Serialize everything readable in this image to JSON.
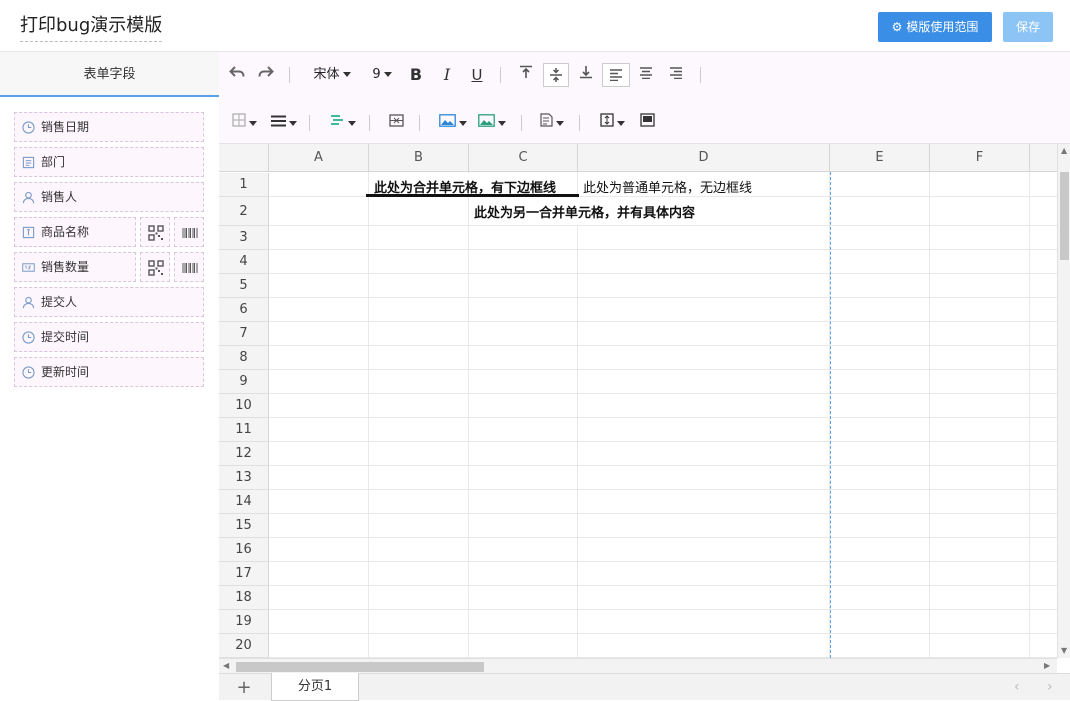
{
  "header": {
    "title": "打印bug演示模版",
    "scope_button": "模版使用范围",
    "save_button": "保存"
  },
  "sidebar": {
    "heading": "表单字段",
    "fields": [
      {
        "label": "销售日期",
        "icon": "clock-icon"
      },
      {
        "label": "部门",
        "icon": "department-icon"
      },
      {
        "label": "销售人",
        "icon": "user-icon"
      },
      {
        "label": "商品名称",
        "icon": "text-field-icon",
        "extras": [
          "qrcode-icon",
          "barcode-icon"
        ]
      },
      {
        "label": "销售数量",
        "icon": "number-field-icon",
        "extras": [
          "qrcode-icon",
          "barcode-icon"
        ]
      },
      {
        "label": "提交人",
        "icon": "user-icon"
      },
      {
        "label": "提交时间",
        "icon": "clock-icon"
      },
      {
        "label": "更新时间",
        "icon": "clock-icon"
      }
    ]
  },
  "toolbar": {
    "font_family": "宋体",
    "font_size": "9"
  },
  "sheet": {
    "columns": [
      "A",
      "B",
      "C",
      "D",
      "E",
      "F"
    ],
    "rows": [
      "1",
      "2",
      "3",
      "4",
      "5",
      "6",
      "7",
      "8",
      "9",
      "10",
      "11",
      "12",
      "13",
      "14",
      "15",
      "16",
      "17",
      "18",
      "19",
      "20"
    ],
    "cells": {
      "merged_b1_c1": "此处为合并单元格，有下边框线",
      "d1": "此处为普通单元格，无边框线",
      "merged_c2_d2": "此处为另一合并单元格，并有具体内容"
    }
  },
  "tabs": {
    "add": "+",
    "page": "分页1"
  },
  "colors": {
    "accent": "#3a8ee6",
    "save": "#8cc4f6",
    "field_bg": "#fdf6fd",
    "print_boundary": "#5ea3ea"
  }
}
